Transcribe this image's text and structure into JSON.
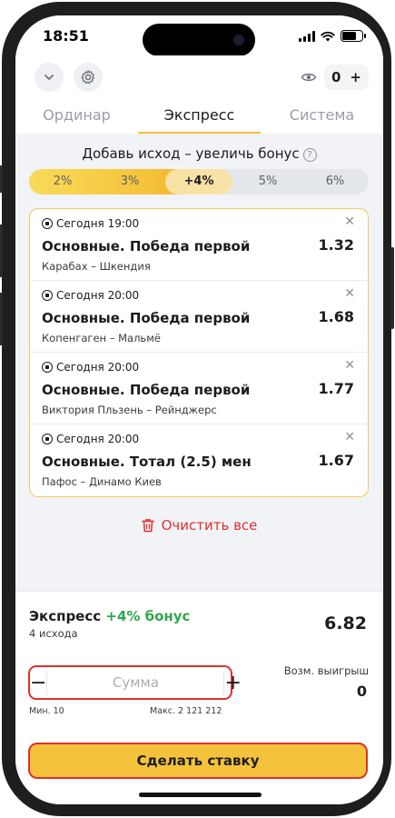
{
  "status_bar": {
    "time": "18:51"
  },
  "topbar": {
    "counter_value": "0",
    "counter_plus": "+"
  },
  "tabs": [
    {
      "label": "Ординар",
      "active": false
    },
    {
      "label": "Экспресс",
      "active": true
    },
    {
      "label": "Система",
      "active": false
    }
  ],
  "bonus": {
    "title": "Добавь исход – увеличь бонус",
    "help": "?",
    "levels": [
      "2%",
      "3%",
      "+4%",
      "5%",
      "6%"
    ],
    "current_index": 2,
    "fill_fraction": 0.58
  },
  "selections": [
    {
      "time": "Сегодня 19:00",
      "market": "Основные. Победа первой",
      "teams": "Карабах – Шкендия",
      "odds": "1.32"
    },
    {
      "time": "Сегодня 20:00",
      "market": "Основные. Победа первой",
      "teams": "Копенгаген – Мальмё",
      "odds": "1.68"
    },
    {
      "time": "Сегодня 20:00",
      "market": "Основные. Победа первой",
      "teams": "Виктория Пльзень – Рейнджерс",
      "odds": "1.77"
    },
    {
      "time": "Сегодня 20:00",
      "market": "Основные. Тотал (2.5) мен",
      "teams": "Пафос – Динамо Киев",
      "odds": "1.67"
    }
  ],
  "clear_all": "Очистить все",
  "slip": {
    "title": "Экспресс",
    "bonus_label": "+4% бонус",
    "count": "4 исхода",
    "total_odds": "6.82",
    "stake_placeholder": "Сумма",
    "minus": "−",
    "plus": "+",
    "win_label": "Возм. выигрыш",
    "win_value": "0",
    "min_label": "Мин. 10",
    "max_label": "Макс. 2 121 212",
    "bet_button": "Сделать ставку"
  },
  "colors": {
    "accent": "#f5c33b",
    "danger": "#e0302b",
    "bonus_green": "#2ea84a"
  }
}
